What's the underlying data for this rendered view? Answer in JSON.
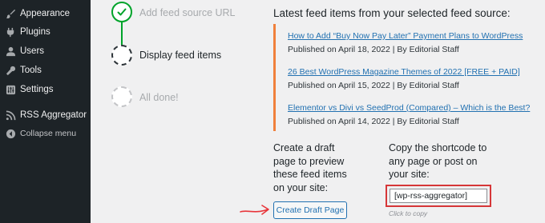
{
  "sidebar": {
    "items": [
      {
        "label": "Appearance",
        "icon": "appearance-brush-icon"
      },
      {
        "label": "Plugins",
        "icon": "plugins-icon"
      },
      {
        "label": "Users",
        "icon": "users-icon"
      },
      {
        "label": "Tools",
        "icon": "tools-wrench-icon"
      },
      {
        "label": "Settings",
        "icon": "settings-icon"
      },
      {
        "label": "RSS Aggregator",
        "icon": "rss-icon"
      },
      {
        "label": "Collapse menu",
        "icon": "collapse-icon"
      }
    ]
  },
  "steps": [
    {
      "label": "Add feed source URL",
      "state": "done"
    },
    {
      "label": "Display feed items",
      "state": "current"
    },
    {
      "label": "All done!",
      "state": "pending"
    }
  ],
  "feed": {
    "title": "Latest feed items from your selected feed source:",
    "items": [
      {
        "title": "How to Add “Buy Now Pay Later” Payment Plans to WordPress",
        "meta": "Published on April 18, 2022 | By Editorial Staff"
      },
      {
        "title": "26 Best WordPress Magazine Themes of 2022 [FREE + PAID]",
        "meta": "Published on April 15, 2022 | By Editorial Staff"
      },
      {
        "title": "Elementor vs Divi vs SeedProd (Compared) – Which is the Best?",
        "meta": "Published on April 14, 2022 | By Editorial Staff"
      }
    ]
  },
  "draft": {
    "text": "Create a draft\npage to preview\nthese feed items\non your site:",
    "button_label": "Create Draft Page"
  },
  "shortcode": {
    "text": "Copy the shortcode to\nany page or post on\nyour site:",
    "value": "[wp-rss-aggregator]",
    "hint": "Click to copy"
  },
  "colors": {
    "sidebar_bg": "#1d2327",
    "step_done": "#00a32a",
    "link": "#2271b1",
    "feed_accent": "#f0803c",
    "highlight": "#d63638",
    "arrow": "#e8353a"
  }
}
